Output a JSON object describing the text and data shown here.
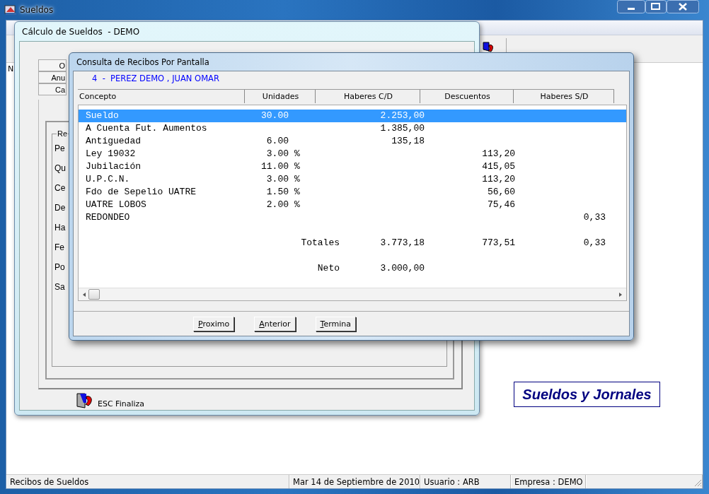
{
  "main_window": {
    "title": "Sueldos",
    "header_label": "N"
  },
  "background_window": {
    "title": "Cálculo de Sueldos  - DEMO",
    "tabs": [
      {
        "label": "O"
      },
      {
        "label": "Anu"
      },
      {
        "label": "Ca"
      }
    ],
    "group_label": "Re",
    "field_labels": [
      "Pe",
      "Qu",
      "Ce",
      "De",
      "Ha",
      "Fe",
      "Po",
      "Sa"
    ],
    "footer_button": "ESC Finaliza"
  },
  "dialog": {
    "title": "Consulta de Recibos Por Pantalla",
    "employee": "4  -  PEREZ DEMO , JUAN OMAR",
    "columns": [
      "Concepto",
      "Unidades",
      "Haberes C/D",
      "Descuentos",
      "Haberes S/D"
    ],
    "rows": [
      {
        "concepto": "Sueldo",
        "unidades": "30.00",
        "haberes_cd": "2.253,00",
        "selected": true
      },
      {
        "concepto": "A Cuenta Fut. Aumentos",
        "haberes_cd": "1.385,00",
        "selected": false
      },
      {
        "concepto": "Antiguedad",
        "unidades": "6.00",
        "haberes_cd": "135,18",
        "selected": false
      },
      {
        "concepto": "Ley 19032",
        "unidades": "3.00",
        "unit": "%",
        "descuentos": "113,20",
        "selected": false
      },
      {
        "concepto": "Jubilación",
        "unidades": "11.00",
        "unit": "%",
        "descuentos": "415,05",
        "selected": false
      },
      {
        "concepto": "U.P.C.N.",
        "unidades": "3.00",
        "unit": "%",
        "descuentos": "113,20",
        "selected": false
      },
      {
        "concepto": "Fdo de Sepelio UATRE",
        "unidades": "1.50",
        "unit": "%",
        "descuentos": "56,60",
        "selected": false
      },
      {
        "concepto": "UATRE LOBOS",
        "unidades": "2.00",
        "unit": "%",
        "descuentos": "75,46",
        "selected": false
      },
      {
        "concepto": "REDONDEO",
        "haberes_sd": "0,33",
        "selected": false
      }
    ],
    "totals": {
      "label": "Totales",
      "haberes_cd": "3.773,18",
      "descuentos": "773,51",
      "haberes_sd": "0,33"
    },
    "net": {
      "label": "Neto",
      "value": "3.000,00"
    },
    "buttons": [
      "Proximo",
      "Anterior",
      "Termina"
    ]
  },
  "brand_box": "Sueldos y Jornales",
  "status_bar": [
    "Recibos de Sueldos",
    "Mar 14 de Septiembre de 2010",
    "Usuario : ARB",
    "Empresa : DEMO"
  ]
}
